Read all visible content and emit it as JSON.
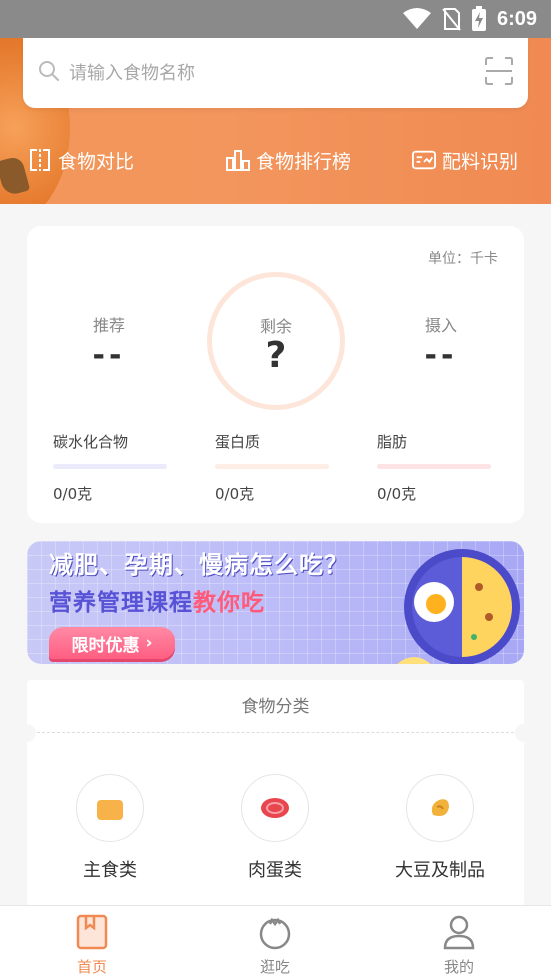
{
  "status_bar": {
    "time": "6:09"
  },
  "search": {
    "placeholder": "请输入食物名称"
  },
  "quick_actions": [
    {
      "label": "食物对比",
      "icon": "compare-icon"
    },
    {
      "label": "食物排行榜",
      "icon": "ranking-icon"
    },
    {
      "label": "配料识别",
      "icon": "ingredient-scan-icon"
    }
  ],
  "summary": {
    "unit": "单位：千卡",
    "recommended": {
      "label": "推荐",
      "value": "--"
    },
    "remaining": {
      "label": "剩余",
      "value": "?"
    },
    "intake": {
      "label": "摄入",
      "value": "--"
    },
    "nutrients": [
      {
        "label": "碳水化合物",
        "value": "0/0克",
        "color": "#ecebfb"
      },
      {
        "label": "蛋白质",
        "value": "0/0克",
        "color": "#fdeee5"
      },
      {
        "label": "脂肪",
        "value": "0/0克",
        "color": "#fde3e3"
      }
    ]
  },
  "banner": {
    "title": "减肥、孕期、慢病怎么吃？",
    "subtitle_main": "营养管理课程",
    "subtitle_highlight": "教你吃",
    "button": "限时优惠"
  },
  "categories": {
    "title": "食物分类",
    "items": [
      {
        "label": "主食类",
        "icon": "bread-icon"
      },
      {
        "label": "肉蛋类",
        "icon": "meat-icon"
      },
      {
        "label": "大豆及制品",
        "icon": "bean-icon"
      }
    ]
  },
  "bottom_nav": [
    {
      "label": "首页",
      "active": true
    },
    {
      "label": "逛吃",
      "active": false
    },
    {
      "label": "我的",
      "active": false
    }
  ],
  "colors": {
    "accent": "#f08a52",
    "active_nav": "#f08a52",
    "inactive_nav": "#888888"
  }
}
